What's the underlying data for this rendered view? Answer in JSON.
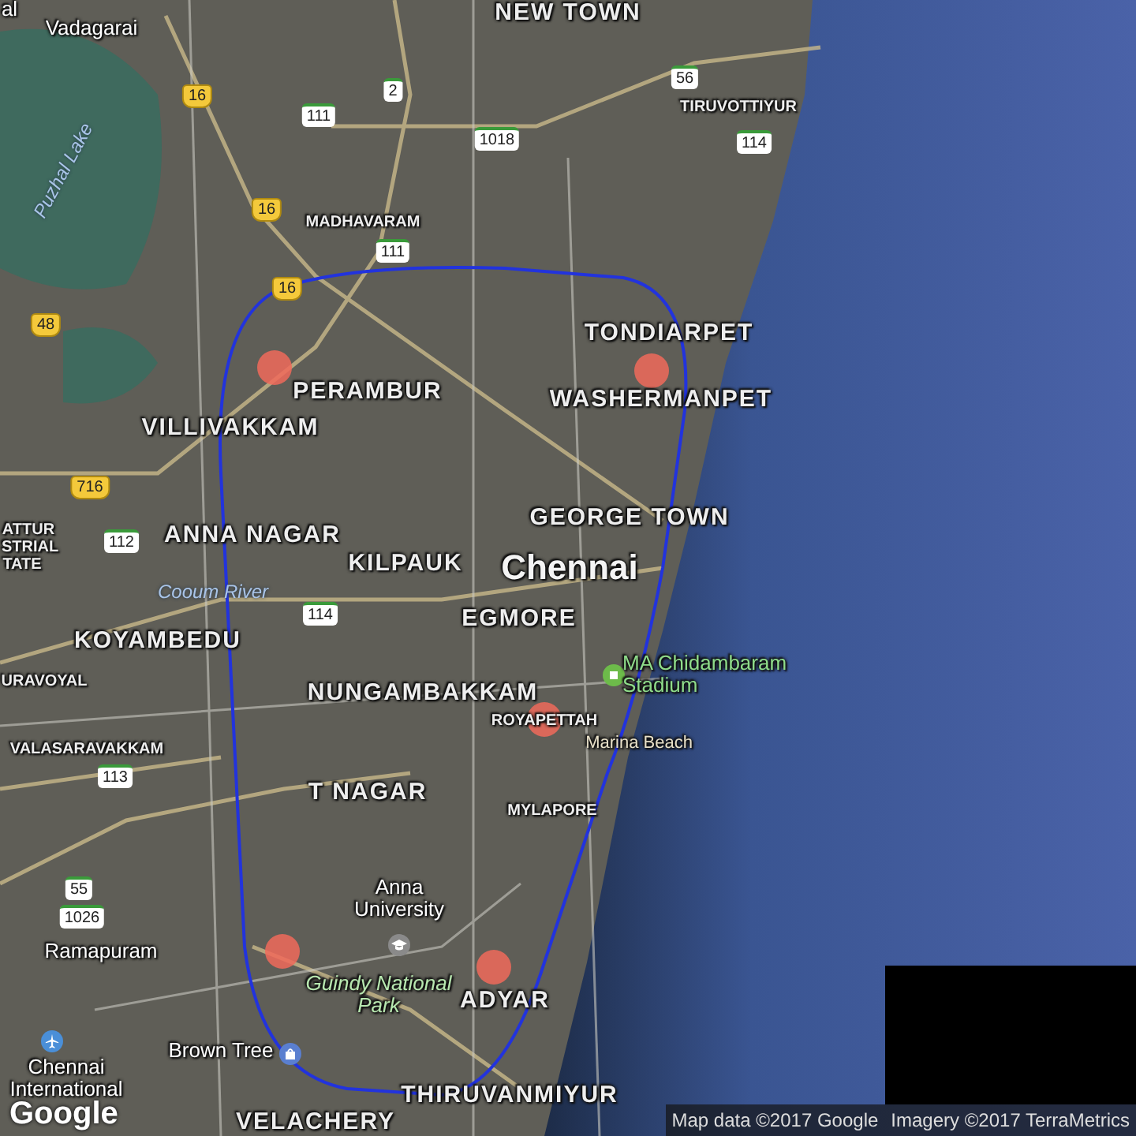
{
  "map": {
    "labels": [
      {
        "text": "al",
        "kind": "locality"
      },
      {
        "text": "NEW TOWN",
        "kind": "district"
      },
      {
        "text": "Vadagarai",
        "kind": "locality"
      },
      {
        "text": "Puzhal Lake",
        "kind": "water"
      },
      {
        "text": "16",
        "kind": "national-highway"
      },
      {
        "text": "111",
        "kind": "state-highway"
      },
      {
        "text": "2",
        "kind": "state-highway"
      },
      {
        "text": "1018",
        "kind": "state-highway"
      },
      {
        "text": "56",
        "kind": "state-highway"
      },
      {
        "text": "TIRUVOTTIYUR",
        "kind": "suburb"
      },
      {
        "text": "114",
        "kind": "state-highway"
      },
      {
        "text": "16",
        "kind": "national-highway"
      },
      {
        "text": "MADHAVARAM",
        "kind": "suburb"
      },
      {
        "text": "111",
        "kind": "state-highway"
      },
      {
        "text": "16",
        "kind": "national-highway"
      },
      {
        "text": "48",
        "kind": "national-highway"
      },
      {
        "text": "TONDIARPET",
        "kind": "district"
      },
      {
        "text": "PERAMBUR",
        "kind": "district"
      },
      {
        "text": "WASHERMANPET",
        "kind": "district"
      },
      {
        "text": "VILLIVAKKAM",
        "kind": "district"
      },
      {
        "text": "716",
        "kind": "national-highway"
      },
      {
        "text": "GEORGE TOWN",
        "kind": "district"
      },
      {
        "text": "ATTUR",
        "kind": "suburb"
      },
      {
        "text": "STRIAL",
        "kind": "suburb"
      },
      {
        "text": "TATE",
        "kind": "suburb"
      },
      {
        "text": "112",
        "kind": "state-highway"
      },
      {
        "text": "ANNA NAGAR",
        "kind": "district"
      },
      {
        "text": "KILPAUK",
        "kind": "district"
      },
      {
        "text": "Chennai",
        "kind": "city"
      },
      {
        "text": "Cooum River",
        "kind": "water"
      },
      {
        "text": "114",
        "kind": "state-highway"
      },
      {
        "text": "EGMORE",
        "kind": "district"
      },
      {
        "text": "KOYAMBEDU",
        "kind": "district"
      },
      {
        "text": "URAVOYAL",
        "kind": "suburb"
      },
      {
        "text": "MA Chidambaram Stadium",
        "kind": "poi"
      },
      {
        "text": "NUNGAMBAKKAM",
        "kind": "district"
      },
      {
        "text": "ROYAPETTAH",
        "kind": "suburb"
      },
      {
        "text": "Marina Beach",
        "kind": "beach"
      },
      {
        "text": "VALASARAVAKKAM",
        "kind": "suburb"
      },
      {
        "text": "113",
        "kind": "state-highway"
      },
      {
        "text": "T NAGAR",
        "kind": "district"
      },
      {
        "text": "MYLAPORE",
        "kind": "suburb"
      },
      {
        "text": "55",
        "kind": "state-highway"
      },
      {
        "text": "1026",
        "kind": "state-highway"
      },
      {
        "text": "Anna University",
        "kind": "locality"
      },
      {
        "text": "Ramapuram",
        "kind": "locality"
      },
      {
        "text": "Guindy National Park",
        "kind": "park"
      },
      {
        "text": "ADYAR",
        "kind": "district"
      },
      {
        "text": "Brown Tree",
        "kind": "locality"
      },
      {
        "text": "Chennai International",
        "kind": "locality"
      },
      {
        "text": "THIRUVANMIYUR",
        "kind": "district"
      },
      {
        "text": "VELACHERY",
        "kind": "district"
      }
    ],
    "attribution": [
      "Map data ©2017 Google",
      "Imagery ©2017 TerraMetrics"
    ],
    "logo": "Google"
  }
}
